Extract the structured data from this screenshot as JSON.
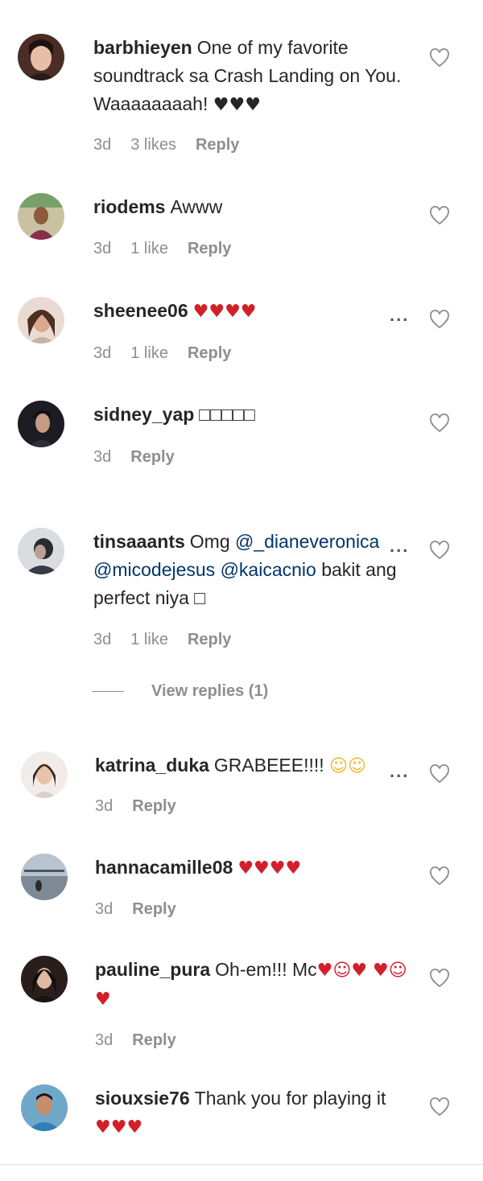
{
  "comments": [
    {
      "username": "barbhieyen",
      "text": "One of my favorite soundtrack sa Crash Landing on You. Waaaaaaaah!",
      "emoji": "♥♥♥",
      "time": "3d",
      "likes": "3 likes",
      "reply": "Reply"
    },
    {
      "username": "riodems",
      "text": "Awww",
      "time": "3d",
      "likes": "1 like",
      "reply": "Reply"
    },
    {
      "username": "sheenee06",
      "emoji": "♥♥♥♥",
      "time": "3d",
      "likes": "1 like",
      "reply": "Reply",
      "more": "..."
    },
    {
      "username": "sidney_yap",
      "text": "□□□□□",
      "time": "3d",
      "reply": "Reply"
    },
    {
      "username": "tinsaaants",
      "text_before": "Omg",
      "mention1": "@_dianeveronica",
      "mention2": "@micodejesus",
      "mention3": "@kaicacnio",
      "text_after": "bakit ang perfect niya □",
      "time": "3d",
      "likes": "1 like",
      "reply": "Reply",
      "more": "..."
    },
    {
      "username": "katrina_duka",
      "text": "GRABEEE!!!!",
      "emoji": "☺☺",
      "time": "3d",
      "reply": "Reply",
      "more": "..."
    },
    {
      "username": "hannacamille08",
      "emoji": "♥♥♥♥",
      "time": "3d",
      "reply": "Reply"
    },
    {
      "username": "pauline_pura",
      "text": "Oh-em!!! Mc",
      "emoji": "♥☺♥ ♥☺♥",
      "time": "3d",
      "reply": "Reply"
    },
    {
      "username": "siouxsie76",
      "text": "Thank you for playing it",
      "emoji": "♥♥♥"
    }
  ],
  "view_replies": "View replies (1)",
  "colors": {
    "heart_red": "#d41f2a",
    "muted": "#8e8e8e",
    "mention": "#003569"
  }
}
